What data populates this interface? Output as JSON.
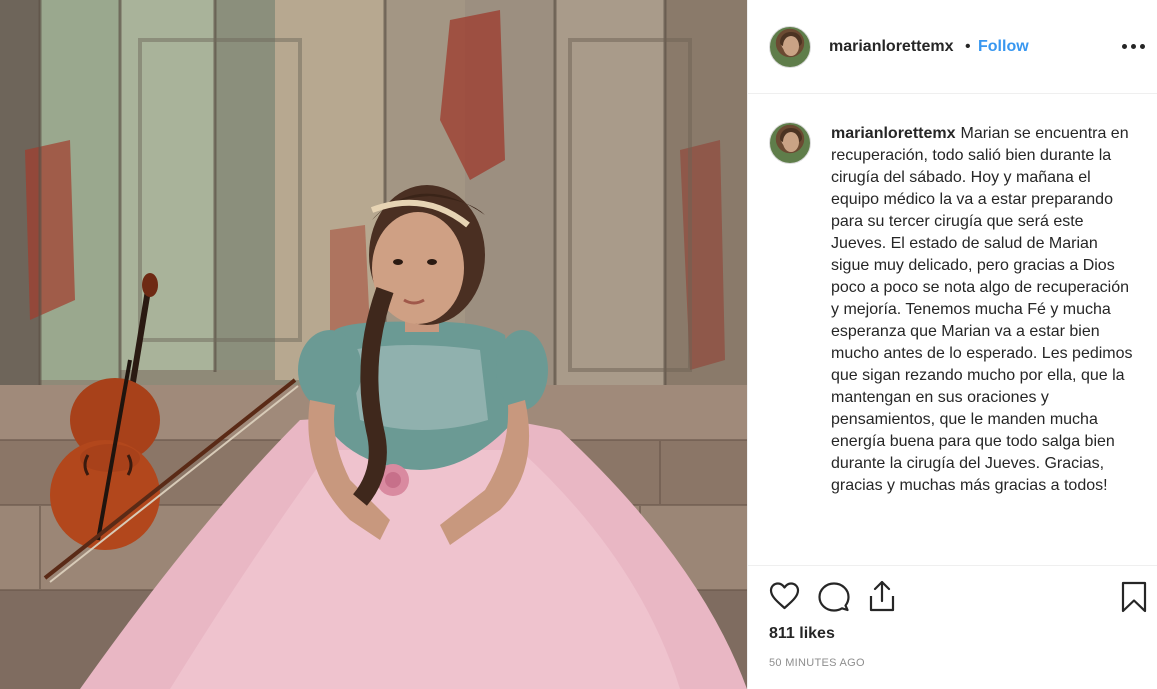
{
  "post": {
    "username": "marianlorettemx",
    "separator": "•",
    "follow_label": "Follow",
    "caption_text": "Marian se encuentra en recuperación, todo salió bien durante la cirugía del sábado. Hoy y mañana el equipo médico la va a estar preparando para su tercer cirugía que será este Jueves. El estado de salud de Marian sigue muy delicado, pero gracias a Dios poco a poco se nota algo de recuperación y mejoría. Tenemos mucha Fé y mucha esperanza que Marian va a estar bien mucho antes de lo esperado. Les pedimos que sigan rezando mucho por ella, que la mantengan en sus oraciones y pensamientos, que le manden mucha energía buena para que todo salga bien durante la cirugía del Jueves. Gracias, gracias y muchas más gracias a todos!",
    "likes": "811 likes",
    "timestamp": "50 MINUTES AGO"
  },
  "icons": {
    "more": "more-options-icon",
    "like": "heart-icon",
    "comment": "comment-icon",
    "share": "share-icon",
    "save": "bookmark-icon"
  },
  "colors": {
    "follow": "#3897f0",
    "text": "#262626",
    "muted": "#8e8e8e",
    "divider": "#efefef"
  }
}
